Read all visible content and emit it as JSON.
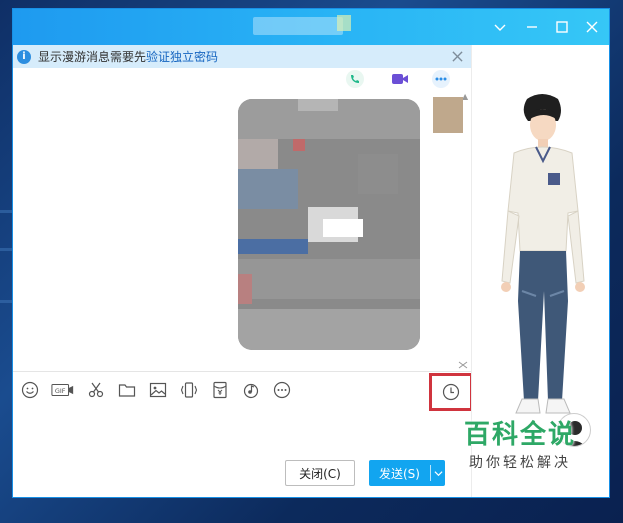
{
  "notice": {
    "text": "显示漫游消息需要先",
    "link": "验证独立密码"
  },
  "buttons": {
    "close_label": "关闭(C)",
    "send_label": "发送(S)"
  },
  "toolbar_icons": [
    "emoji-icon",
    "gif-icon",
    "scissors-icon",
    "folder-icon",
    "image-icon",
    "shake-icon",
    "red-packet-icon",
    "music-icon",
    "more-icon"
  ],
  "watermark": {
    "title": "百科全说",
    "subtitle": "助你轻松解决"
  },
  "colors": {
    "title_bar": "#1e9af0",
    "send_button": "#12a5f0",
    "highlight_border": "#d0343e",
    "notice_bg": "#d6ecfb",
    "watermark_green": "#2ea866"
  }
}
